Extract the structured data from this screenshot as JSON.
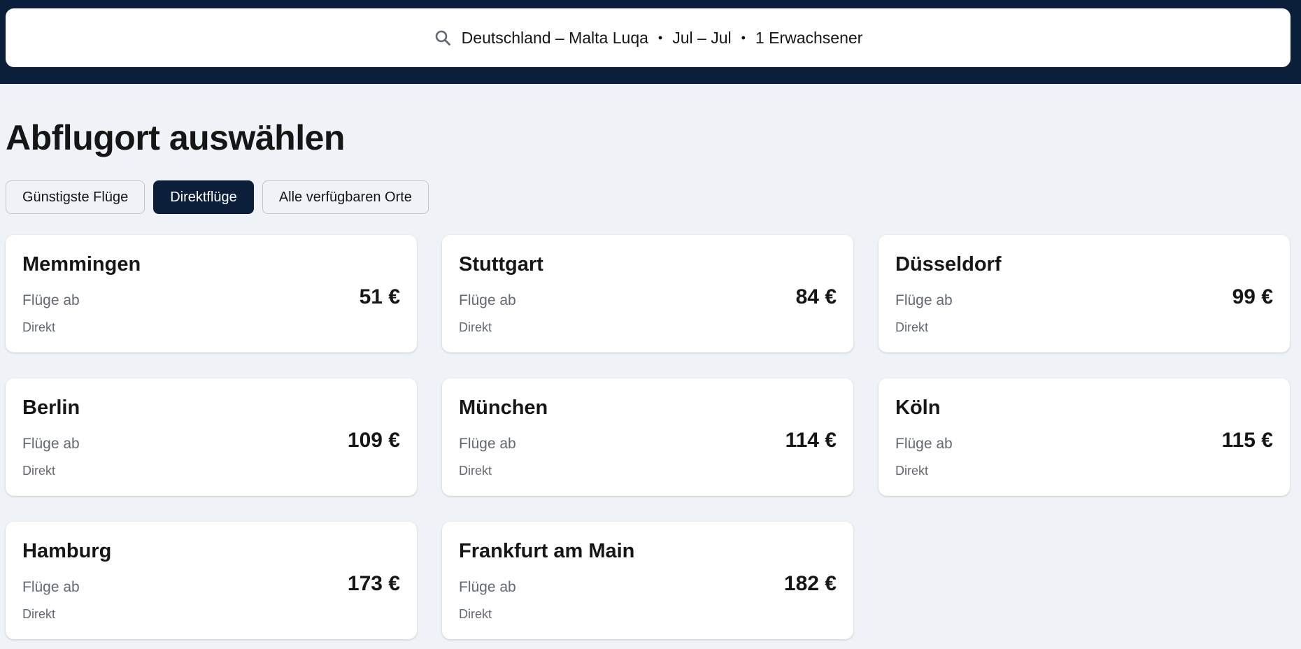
{
  "search": {
    "route": "Deutschland – Malta Luqa",
    "dates": "Jul – Jul",
    "passengers": "1 Erwachsener",
    "separator": "•"
  },
  "page": {
    "title": "Abflugort auswählen"
  },
  "filters": [
    {
      "label": "Günstigste Flüge",
      "active": false
    },
    {
      "label": "Direktflüge",
      "active": true
    },
    {
      "label": "Alle verfügbaren Orte",
      "active": false
    }
  ],
  "destinations": [
    {
      "city": "Memmingen",
      "from_label": "Flüge ab",
      "price": "51 €",
      "stops": "Direkt"
    },
    {
      "city": "Stuttgart",
      "from_label": "Flüge ab",
      "price": "84 €",
      "stops": "Direkt"
    },
    {
      "city": "Düsseldorf",
      "from_label": "Flüge ab",
      "price": "99 €",
      "stops": "Direkt"
    },
    {
      "city": "Berlin",
      "from_label": "Flüge ab",
      "price": "109 €",
      "stops": "Direkt"
    },
    {
      "city": "München",
      "from_label": "Flüge ab",
      "price": "114 €",
      "stops": "Direkt"
    },
    {
      "city": "Köln",
      "from_label": "Flüge ab",
      "price": "115 €",
      "stops": "Direkt"
    },
    {
      "city": "Hamburg",
      "from_label": "Flüge ab",
      "price": "173 €",
      "stops": "Direkt"
    },
    {
      "city": "Frankfurt am Main",
      "from_label": "Flüge ab",
      "price": "182 €",
      "stops": "Direkt"
    }
  ],
  "colors": {
    "header_bg": "#0b1f3b",
    "page_bg": "#eff3f8",
    "active_chip": "#0b1f3b"
  },
  "icons": {
    "search": "search-icon"
  }
}
